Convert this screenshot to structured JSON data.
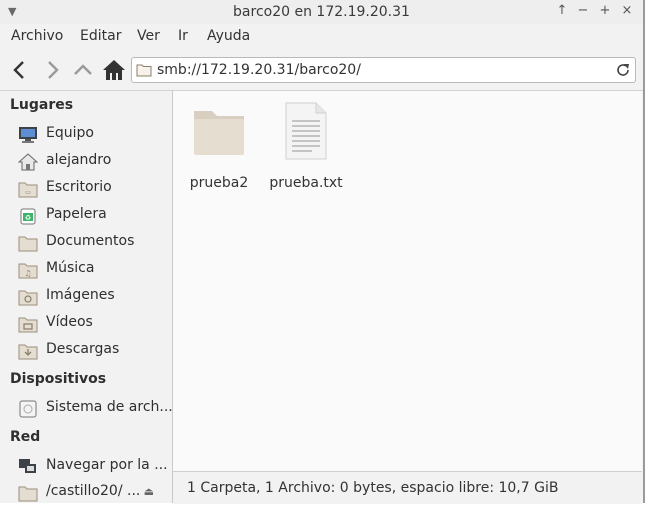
{
  "window": {
    "title": "barco20 en 172.19.20.31",
    "controls": [
      "up-arrow",
      "minus",
      "plus",
      "close"
    ]
  },
  "menubar": {
    "items": [
      "Archivo",
      "Editar",
      "Ver",
      "Ir",
      "Ayuda"
    ]
  },
  "toolbar": {
    "back_icon": "arrow-left-icon",
    "forward_icon": "arrow-right-icon",
    "up_icon": "arrow-up-icon",
    "home_icon": "home-icon",
    "path": "smb://172.19.20.31/barco20/",
    "reload_icon": "reload-icon"
  },
  "sidebar": {
    "places_title": "Lugares",
    "places": [
      {
        "label": "Equipo",
        "icon": "computer-icon"
      },
      {
        "label": "alejandro",
        "icon": "home-icon"
      },
      {
        "label": "Escritorio",
        "icon": "desktop-folder-icon"
      },
      {
        "label": "Papelera",
        "icon": "trash-icon"
      },
      {
        "label": "Documentos",
        "icon": "documents-folder-icon"
      },
      {
        "label": "Música",
        "icon": "music-folder-icon"
      },
      {
        "label": "Imágenes",
        "icon": "pictures-folder-icon"
      },
      {
        "label": "Vídeos",
        "icon": "videos-folder-icon"
      },
      {
        "label": "Descargas",
        "icon": "downloads-folder-icon"
      }
    ],
    "devices_title": "Dispositivos",
    "devices": [
      {
        "label": "Sistema de arch...",
        "icon": "drive-icon"
      }
    ],
    "network_title": "Red",
    "network": [
      {
        "label": "Navegar por la ...",
        "icon": "network-icon"
      },
      {
        "label": "/castillo20/ ...",
        "icon": "folder-icon"
      }
    ]
  },
  "files": [
    {
      "name": "prueba2",
      "type": "folder"
    },
    {
      "name": "prueba.txt",
      "type": "text-file"
    }
  ],
  "status": {
    "text": "1 Carpeta, 1 Archivo: 0 bytes, espacio libre: 10,7 GiB"
  }
}
